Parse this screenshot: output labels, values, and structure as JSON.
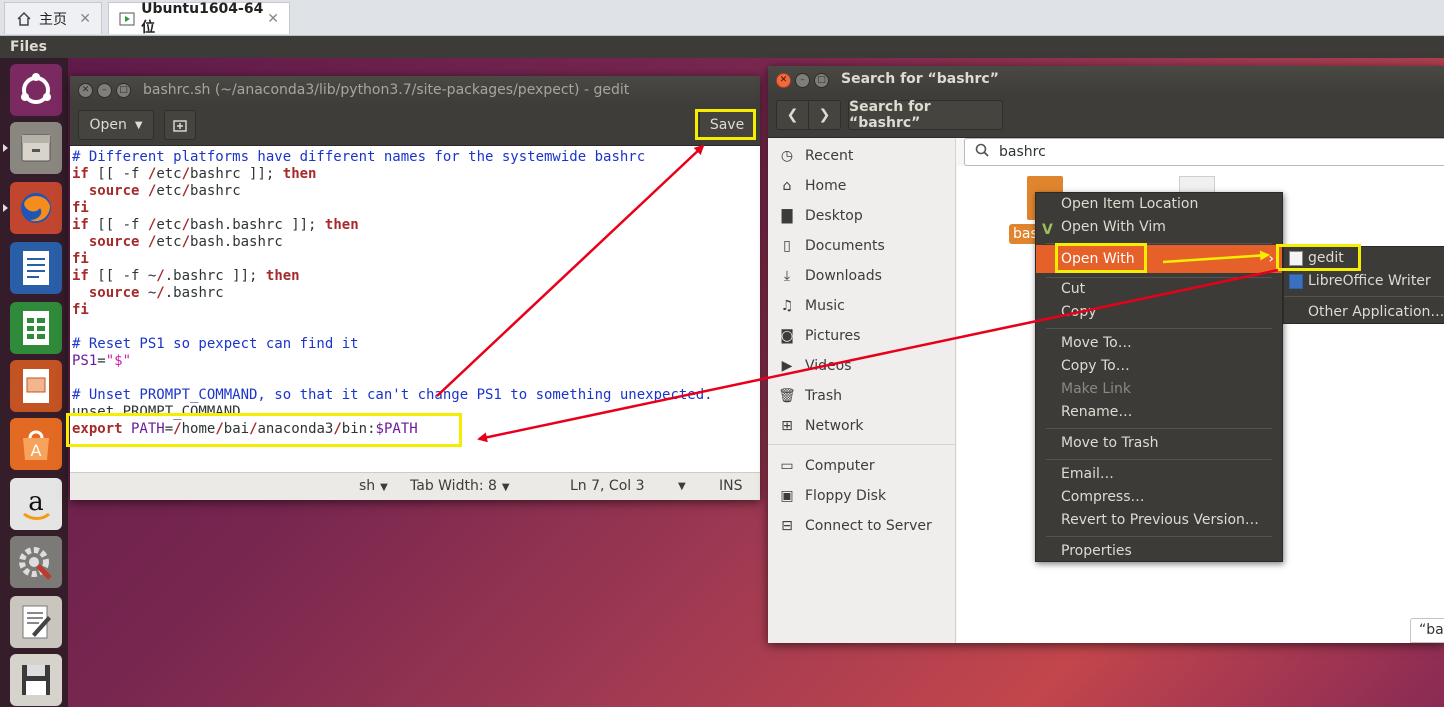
{
  "vm_tabs": [
    {
      "label": "主页",
      "icon": "home-icon"
    },
    {
      "label": "Ubuntu1604-64 位",
      "icon": "vm-play-icon"
    }
  ],
  "top_bar": {
    "app_name": "Files"
  },
  "launcher": [
    "ubuntu-dash-icon",
    "files-icon",
    "firefox-icon",
    "libreoffice-writer-icon",
    "libreoffice-calc-icon",
    "libreoffice-impress-icon",
    "software-center-icon",
    "amazon-icon",
    "system-settings-icon",
    "text-editor-icon",
    "save-icon"
  ],
  "gedit": {
    "title": "bashrc.sh (~/anaconda3/lib/python3.7/site-packages/pexpect) - gedit",
    "open_label": "Open",
    "save_label": "Save",
    "code": {
      "l1": "# Different platforms have different names for the systemwide bashrc",
      "l2_kw": "if",
      "l2_a": " [[ -f ",
      "l2_slash": "/",
      "l2_b": "etc",
      "l2_slash2": "/",
      "l2_c": "bashrc ]]; ",
      "l2_kw2": "then",
      "l3_kw": "  source",
      "l3_a": " ",
      "l3_slash": "/",
      "l3_b": "etc",
      "l3_slash2": "/",
      "l3_c": "bashrc",
      "l4": "fi",
      "l5_kw": "if",
      "l5_a": " [[ -f ",
      "l5_slash": "/",
      "l5_b": "etc",
      "l5_slash2": "/",
      "l5_c": "bash.bashrc ]]; ",
      "l5_kw2": "then",
      "l6_kw": "  source",
      "l6_a": " ",
      "l6_slash": "/",
      "l6_b": "etc",
      "l6_slash2": "/",
      "l6_c": "bash.bashrc",
      "l7": "fi",
      "l8_kw": "if",
      "l8_a": " [[ -f ~",
      "l8_slash": "/",
      "l8_c": ".bashrc ]]; ",
      "l8_kw2": "then",
      "l9_kw": "  source",
      "l9_a": " ~",
      "l9_slash": "/",
      "l9_c": ".bashrc",
      "l10": "fi",
      "l12": "# Reset PS1 so pexpect can find it",
      "l13_var": "PS1",
      "l13_eq": "=",
      "l13_str": "\"$\"",
      "l15": "# Unset PROMPT_COMMAND, so that it can't change PS1 to something unexpected.",
      "l16": "unset PROMPT_COMMAND",
      "l17_kw": "export",
      "l17_var": " PATH",
      "l17_eq": "=",
      "l17_s1": "/",
      "l17_p1": "home",
      "l17_s2": "/",
      "l17_p2": "bai",
      "l17_s3": "/",
      "l17_p3": "anaconda3",
      "l17_s4": "/",
      "l17_p4": "bin:",
      "l17_var2": "$PATH"
    },
    "status": {
      "lang": "sh",
      "tab_width": "Tab Width: 8",
      "position": "Ln 7, Col 3",
      "mode": "INS"
    }
  },
  "files": {
    "title": "Search for “bashrc”",
    "path_button": "Search for “bashrc”",
    "search_value": "bashrc",
    "sidebar": [
      {
        "label": "Recent",
        "icon": "clock-icon"
      },
      {
        "label": "Home",
        "icon": "home-icon"
      },
      {
        "label": "Desktop",
        "icon": "folder-icon"
      },
      {
        "label": "Documents",
        "icon": "document-icon"
      },
      {
        "label": "Downloads",
        "icon": "download-icon"
      },
      {
        "label": "Music",
        "icon": "music-icon"
      },
      {
        "label": "Pictures",
        "icon": "camera-icon"
      },
      {
        "label": "Videos",
        "icon": "video-icon"
      },
      {
        "label": "Trash",
        "icon": "trash-icon"
      },
      {
        "label": "Network",
        "icon": "network-icon"
      },
      {
        "label": "Computer",
        "icon": "computer-icon"
      },
      {
        "label": "Floppy Disk",
        "icon": "floppy-icon"
      },
      {
        "label": "Connect to Server",
        "icon": "server-icon"
      }
    ],
    "file_label": "bas",
    "status_bubble": "“ba"
  },
  "context_menu": {
    "items": [
      "Open Item Location",
      "Open With Vim",
      "Open With",
      "Cut",
      "Copy",
      "Move To…",
      "Copy To…",
      "Make Link",
      "Rename…",
      "Move to Trash",
      "Email…",
      "Compress…",
      "Revert to Previous Version…",
      "Properties"
    ],
    "vim_marker": "V"
  },
  "submenu": {
    "items": [
      "gedit",
      "LibreOffice Writer",
      "Other Application…"
    ]
  },
  "annotation_colors": {
    "highlight": "#f5ee00",
    "arrow_red": "#e8001a",
    "arrow_yellow": "#f5ee00"
  }
}
